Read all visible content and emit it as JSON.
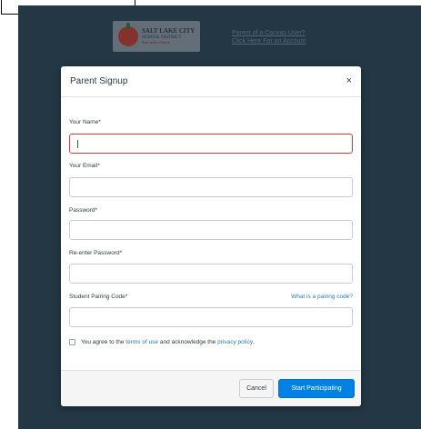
{
  "background": {
    "logo": {
      "line1": "SALT LAKE CITY",
      "line2": "SCHOOL DISTRICT",
      "line3": "Start with a Choice"
    },
    "parent_link": {
      "line1": "Parent of a Canvas User?",
      "line2": "Click Here For an Account"
    }
  },
  "modal": {
    "title": "Parent Signup",
    "close_symbol": "×",
    "fields": {
      "name": {
        "label": "Your Name*",
        "value": ""
      },
      "email": {
        "label": "Your Email*",
        "value": ""
      },
      "password": {
        "label": "Password*",
        "value": ""
      },
      "reenter_password": {
        "label": "Re-enter Password*",
        "value": ""
      },
      "pairing_code": {
        "label": "Student Pairing Code*",
        "value": ""
      }
    },
    "pairing_help_link": "What is a pairing code?",
    "agreement": {
      "prefix": "You agree to the",
      "terms_link": "terms of use",
      "middle": "and acknowledge the",
      "privacy_link": "privacy policy",
      "suffix": "."
    },
    "footer": {
      "cancel_label": "Cancel",
      "submit_label": "Start Participating"
    }
  },
  "colors": {
    "page_background": "#2a4152",
    "primary_button": "#0081e3",
    "link": "#2a7abc",
    "focus_border": "#e0373e"
  },
  "icons": {
    "close": "close-icon",
    "checkbox": "checkbox-icon"
  }
}
